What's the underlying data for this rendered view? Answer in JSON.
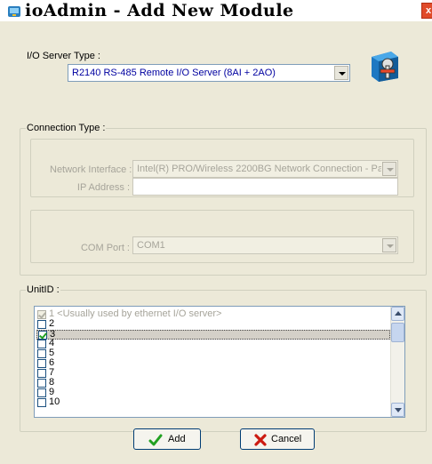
{
  "window": {
    "title": "ioAdmin - Add New Module",
    "close_glyph": "x"
  },
  "io_server": {
    "label": "I/O Server Type :",
    "selected": "R2140  RS-485 Remote I/O Server (8AI + 2AO)"
  },
  "connection": {
    "group_title": "Connection Type :",
    "network_interface_label": "Network Interface :",
    "network_interface_value": "Intel(R) PRO/Wireless 2200BG Network Connection - Pac",
    "ip_address_label": "IP Address :",
    "ip_address_value": "",
    "com_port_label": "COM Port :",
    "com_port_value": "COM1"
  },
  "unit_id": {
    "group_title": "UnitID :",
    "items": [
      {
        "label": "1 <Usually used by ethernet I/O server>",
        "checked": true,
        "disabled": true
      },
      {
        "label": "2",
        "checked": false,
        "disabled": false
      },
      {
        "label": "3",
        "checked": true,
        "disabled": false,
        "selected": true
      },
      {
        "label": "4",
        "checked": false,
        "disabled": false
      },
      {
        "label": "5",
        "checked": false,
        "disabled": false
      },
      {
        "label": "6",
        "checked": false,
        "disabled": false
      },
      {
        "label": "7",
        "checked": false,
        "disabled": false
      },
      {
        "label": "8",
        "checked": false,
        "disabled": false
      },
      {
        "label": "9",
        "checked": false,
        "disabled": false
      },
      {
        "label": "10",
        "checked": false,
        "disabled": false
      }
    ]
  },
  "buttons": {
    "add_label": "Add",
    "cancel_label": "Cancel"
  },
  "icons": {
    "title": "app-icon",
    "module": "module-tool-icon",
    "add": "check-icon",
    "cancel": "x-icon"
  },
  "colors": {
    "dialog_bg": "#ece9d8",
    "selection_text": "#0000a0",
    "check_green": "#21a121",
    "cancel_red": "#cc1b12",
    "disabled_text": "#a6a49a"
  }
}
